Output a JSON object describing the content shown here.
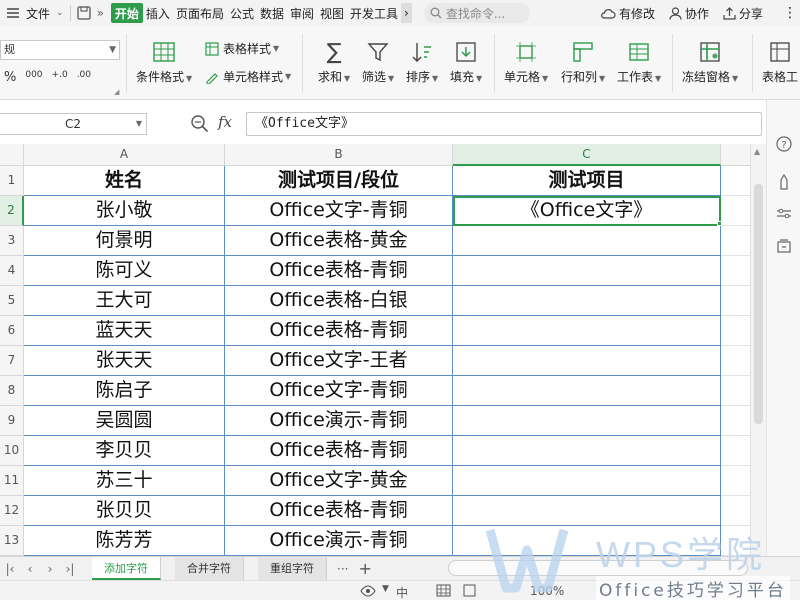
{
  "menubar": {
    "file": "文件",
    "tabs": [
      "开始",
      "插入",
      "页面布局",
      "公式",
      "数据",
      "审阅",
      "视图",
      "开发工具"
    ],
    "search_placeholder": "查找命令...",
    "has_changes": "有修改",
    "collab": "协作",
    "share": "分享"
  },
  "ribbon": {
    "number_format": "规",
    "number_buttons": [
      "%",
      "000",
      "+.0",
      ".00"
    ],
    "conditional_format": "条件格式",
    "table_style": "表格样式",
    "cell_style": "单元格样式",
    "sum": "求和",
    "filter": "筛选",
    "sort": "排序",
    "fill": "填充",
    "cell": "单元格",
    "row_col": "行和列",
    "worksheet": "工作表",
    "freeze": "冻结窗格",
    "table_tool": "表格工"
  },
  "formula_bar": {
    "cell_ref": "C2",
    "fx": "fx",
    "content": "《Office文字》"
  },
  "sheet": {
    "columns": [
      "A",
      "B",
      "C"
    ],
    "rows": [
      "1",
      "2",
      "3",
      "4",
      "5",
      "6",
      "7",
      "8",
      "9",
      "10",
      "11",
      "12",
      "13"
    ],
    "header": [
      "姓名",
      "测试项目/段位",
      "测试项目"
    ],
    "data": [
      [
        "张小敬",
        "Office文字-青铜",
        "《Office文字》"
      ],
      [
        "何景明",
        "Office表格-黄金",
        ""
      ],
      [
        "陈可义",
        "Office表格-青铜",
        ""
      ],
      [
        "王大可",
        "Office表格-白银",
        ""
      ],
      [
        "蓝天天",
        "Office表格-青铜",
        ""
      ],
      [
        "张天天",
        "Office文字-王者",
        ""
      ],
      [
        "陈启子",
        "Office文字-青铜",
        ""
      ],
      [
        "吴圆圆",
        "Office演示-青铜",
        ""
      ],
      [
        "李贝贝",
        "Office表格-青铜",
        ""
      ],
      [
        "苏三十",
        "Office文字-黄金",
        ""
      ],
      [
        "张贝贝",
        "Office表格-青铜",
        ""
      ],
      [
        "陈芳芳",
        "Office演示-青铜",
        ""
      ]
    ]
  },
  "sheet_tabs": [
    "添加字符",
    "合并字符",
    "重组字符"
  ],
  "statusbar": {
    "zoom": "100%"
  },
  "watermark": {
    "title": "WPS学院",
    "subtitle": "Office技巧学习平台"
  },
  "colors": {
    "accent": "#2e9c4a",
    "border_blue": "#5b8ec9"
  }
}
